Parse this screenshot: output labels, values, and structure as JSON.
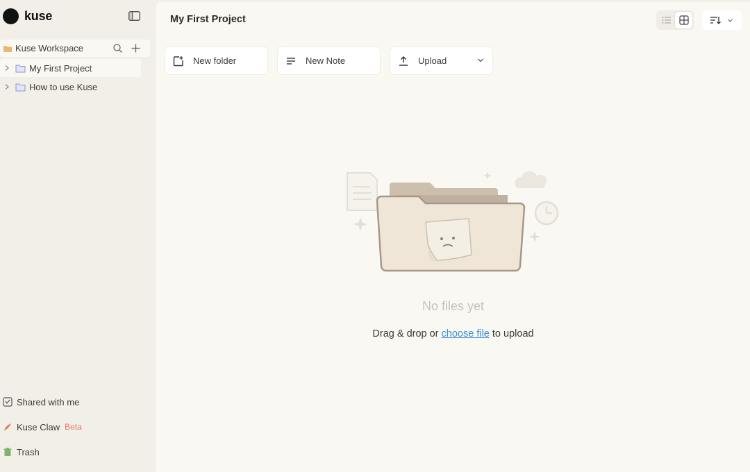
{
  "brand": {
    "name": "kuse"
  },
  "sidebar": {
    "workspace": {
      "label": "Kuse Workspace"
    },
    "tree": [
      {
        "label": "My First Project",
        "active": true
      },
      {
        "label": "How to use Kuse",
        "active": false
      }
    ],
    "bottom": [
      {
        "label": "Shared with me",
        "icon": "shared-icon"
      },
      {
        "label": "Kuse Claw",
        "icon": "claw-icon",
        "badge": "Beta"
      },
      {
        "label": "Trash",
        "icon": "trash-icon"
      }
    ]
  },
  "main": {
    "title": "My First Project",
    "view_mode": "grid",
    "actions": [
      {
        "label": "New folder",
        "icon": "new-folder-icon"
      },
      {
        "label": "New Note",
        "icon": "note-icon"
      },
      {
        "label": "Upload",
        "icon": "upload-icon"
      }
    ],
    "empty": {
      "title": "No files yet",
      "sub_before": "Drag & drop or ",
      "link": "choose file",
      "sub_after": " to upload"
    }
  },
  "colors": {
    "background": "#f2efe8",
    "panel": "#faf8f3",
    "accent_link": "#3b8fd6",
    "beta": "#e07a5f",
    "workspace_folder": "#e8b877"
  }
}
